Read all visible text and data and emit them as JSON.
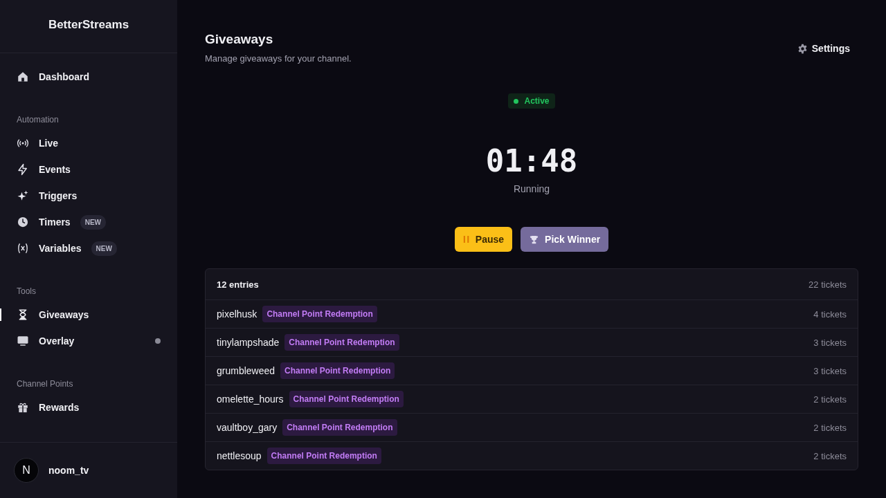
{
  "sidebar": {
    "logo": "BetterStreams",
    "sections": [
      {
        "items": [
          {
            "label": "Dashboard",
            "selected": false
          }
        ]
      },
      {
        "title": "Automation",
        "items": [
          {
            "label": "Live",
            "selected": false
          },
          {
            "label": "Events",
            "selected": false
          },
          {
            "label": "Triggers",
            "selected": false
          },
          {
            "label": "Timers",
            "badge": "NEW",
            "selected": false
          },
          {
            "label": "Variables",
            "badge": "NEW",
            "selected": false
          }
        ]
      },
      {
        "title": "Tools",
        "items": [
          {
            "label": "Giveaways",
            "selected": true
          },
          {
            "label": "Overlay",
            "indicator": true,
            "selected": false
          }
        ]
      },
      {
        "title": "Channel Points",
        "items": [
          {
            "label": "Rewards",
            "selected": false
          }
        ]
      }
    ],
    "user": {
      "initial": "N",
      "name": "noom_tv"
    }
  },
  "header": {
    "title": "Giveaways",
    "subtitle": "Manage giveaways for your channel.",
    "settings": "Settings"
  },
  "status": {
    "label": "Active",
    "active": true
  },
  "timer": {
    "time": "01:48",
    "state": "Running"
  },
  "actions": [
    {
      "kind": "pause",
      "label": "Pause"
    },
    {
      "kind": "pick",
      "label": "Pick Winner"
    }
  ],
  "entries": {
    "count": "12 entries",
    "total": "22 tickets",
    "rows": [
      {
        "name": "pixelhusk",
        "source": "Channel Point Redemption",
        "tickets": "4 tickets"
      },
      {
        "name": "tinylampshade",
        "source": "Channel Point Redemption",
        "tickets": "3 tickets"
      },
      {
        "name": "grumbleweed",
        "source": "Channel Point Redemption",
        "tickets": "3 tickets"
      },
      {
        "name": "omelette_hours",
        "source": "Channel Point Redemption",
        "tickets": "2 tickets"
      },
      {
        "name": "vaultboy_gary",
        "source": "Channel Point Redemption",
        "tickets": "2 tickets"
      },
      {
        "name": "nettlesoup",
        "source": "Channel Point Redemption",
        "tickets": "2 tickets"
      }
    ]
  }
}
